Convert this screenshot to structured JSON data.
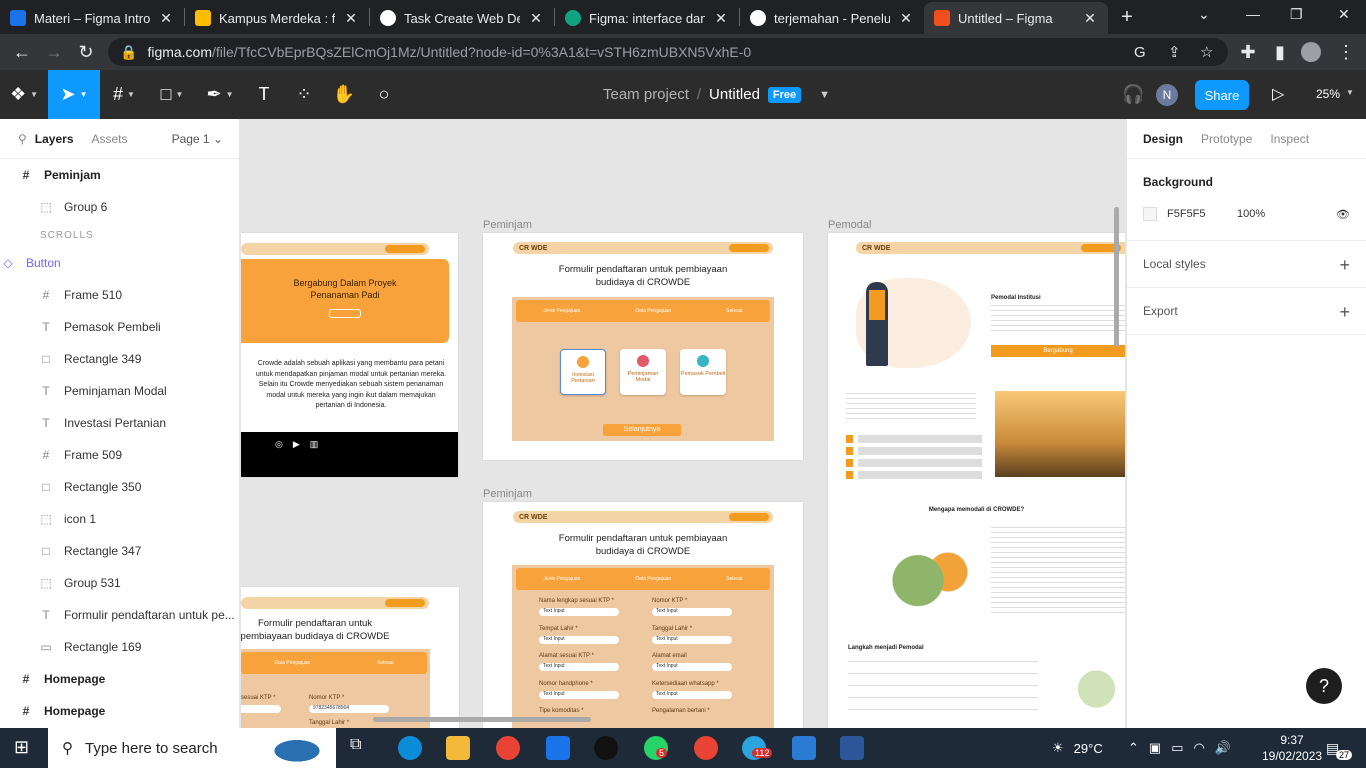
{
  "browser": {
    "tabs": [
      {
        "title": "Materi – Figma Introd",
        "color": "#1a73e8"
      },
      {
        "title": "Kampus Merdeka : fig",
        "color": "#fbbc04"
      },
      {
        "title": "Task Create Web Desig",
        "color": "#ffffff"
      },
      {
        "title": "Figma: interface dan fi",
        "color": "#10a37f"
      },
      {
        "title": "terjemahan - Penelus",
        "color": "#ffffff"
      },
      {
        "title": "Untitled – Figma",
        "color": "#f24e1e"
      }
    ],
    "new_tab": "+",
    "url_host": "figma.com",
    "url_rest": "/file/TfcCVbEprBQsZElCmOj1Mz/Untitled?node-id=0%3A1&t=vSTH6zmUBXN5VxhE-0",
    "close_glyph": "✕"
  },
  "toolbar": {
    "team": "Team project",
    "separator": "/",
    "file_name": "Untitled",
    "plan_badge": "Free",
    "avatar_letter": "N",
    "share_label": "Share",
    "zoom": "25%"
  },
  "left_panel": {
    "tab_layers": "Layers",
    "tab_assets": "Assets",
    "page": "Page 1",
    "layers": [
      {
        "name": "Peminjam",
        "icon": "#",
        "kind": "top"
      },
      {
        "name": "Group 6",
        "icon": "⬚",
        "kind": "child"
      },
      {
        "name": "SCROLLS",
        "icon": "",
        "kind": "section"
      },
      {
        "name": "Button",
        "icon": "◇",
        "kind": "purple"
      },
      {
        "name": "Frame 510",
        "icon": "#",
        "kind": "child"
      },
      {
        "name": "Pemasok Pembeli",
        "icon": "T",
        "kind": "child"
      },
      {
        "name": "Rectangle 349",
        "icon": "□",
        "kind": "child"
      },
      {
        "name": "Peminjaman Modal",
        "icon": "T",
        "kind": "child"
      },
      {
        "name": "Investasi Pertanian",
        "icon": "T",
        "kind": "child"
      },
      {
        "name": "Frame 509",
        "icon": "#",
        "kind": "child"
      },
      {
        "name": "Rectangle 350",
        "icon": "□",
        "kind": "child"
      },
      {
        "name": "icon 1",
        "icon": "⬚",
        "kind": "child"
      },
      {
        "name": "Rectangle 347",
        "icon": "□",
        "kind": "child"
      },
      {
        "name": "Group 531",
        "icon": "⬚",
        "kind": "child"
      },
      {
        "name": "Formulir pendaftaran untuk pe...",
        "icon": "T",
        "kind": "child"
      },
      {
        "name": "Rectangle 169",
        "icon": "▭",
        "kind": "child"
      },
      {
        "name": "Homepage",
        "icon": "#",
        "kind": "top"
      },
      {
        "name": "Homepage",
        "icon": "#",
        "kind": "top"
      }
    ]
  },
  "canvas": {
    "label_peminjam_1": "Peminjam",
    "label_pemodal": "Pemodal",
    "label_peminjam_2": "Peminjam",
    "logo": "CR  WDE",
    "home_headline": "Bergabung Dalam Proyek Penanaman Padi",
    "home_body": "Crowde adalah sebuah aplikasi yang membantu para petani untuk mendapatkan pinjaman modal untuk pertanian mereka. Selain itu Crowde menyediakan sebuah sistem penanaman modal untuk mereka yang ingin ikut dalam memajukan pertanian di Indonesia.",
    "form_title": "Formulir pendaftaran untuk pembiayaan budidaya di CROWDE",
    "form_title_cut": "Formulir pendaftaran untuk pembiayaan budidaya di CROWDE",
    "cards": [
      "Investasi Pertanian",
      "Peminjaman Modal",
      "Pemasok Pembeli"
    ],
    "next_button": "Selanjutnya",
    "steps": [
      "Jenis Pengajuan",
      "Data Pengajuan",
      "Selesai"
    ],
    "fields_left": [
      "Nama lengkap sesuai KTP *",
      "Tempat Lahir *",
      "Alamat sesuai KTP *",
      "Nomor handphone *",
      "Tipe komoditas *"
    ],
    "fields_right": [
      "Nomor KTP *",
      "Tanggal Lahir *",
      "Alamat email",
      "Ketersediaan whatsapp *",
      "Pengalaman bertani *"
    ],
    "text_input": "Text Input",
    "pemodal_title": "Pemodal Institusi",
    "pemodal_button": "Bergabung",
    "why_title": "Mengapa memodali di CROWDE?",
    "steps_title": "Langkah menjadi Pemodal",
    "partial_ktp_label": "sesuai KTP *",
    "partial_ktp_value": "9782345678904",
    "partial_birth_label": "Tanggal Lahir *"
  },
  "right_panel": {
    "tab_design": "Design",
    "tab_prototype": "Prototype",
    "tab_inspect": "Inspect",
    "background_label": "Background",
    "background_hex": "F5F5F5",
    "background_opacity": "100%",
    "local_styles": "Local styles",
    "export": "Export"
  },
  "help": "?",
  "taskbar": {
    "search_placeholder": "Type here to search",
    "weather": "29°C",
    "time": "9:37",
    "date": "19/02/2023",
    "notif_count": "27",
    "whatsapp_badge": "5",
    "telegram_badge": "112"
  }
}
